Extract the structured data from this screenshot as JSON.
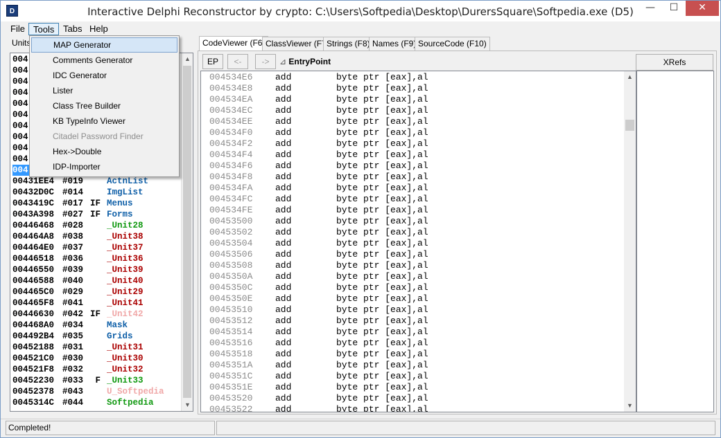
{
  "window": {
    "title": "Interactive Delphi Reconstructor by crypto: C:\\Users\\Softpedia\\Desktop\\DurersSquare\\Softpedia.exe (D5)",
    "icon_text": "D",
    "minimize": "—",
    "maximize": "☐",
    "close": "✕"
  },
  "menu": [
    "File",
    "Tools",
    "Tabs",
    "Help"
  ],
  "tools_menu": {
    "items": [
      {
        "label": "MAP Generator",
        "state": "highlighted"
      },
      {
        "label": "Comments Generator",
        "state": "normal"
      },
      {
        "label": "IDC Generator",
        "state": "normal"
      },
      {
        "label": "Lister",
        "state": "normal"
      },
      {
        "label": "Class Tree Builder",
        "state": "normal"
      },
      {
        "label": "KB TypeInfo Viewer",
        "state": "normal"
      },
      {
        "label": "Citadel Password Finder",
        "state": "disabled"
      },
      {
        "label": "Hex->Double",
        "state": "normal"
      },
      {
        "label": "IDP-Importer",
        "state": "normal"
      }
    ]
  },
  "left_panel": {
    "header": "Units",
    "hidden_rows": [
      {
        "addr": "004",
        "num": ""
      },
      {
        "addr": "004",
        "num": ""
      },
      {
        "addr": "004",
        "num": ""
      },
      {
        "addr": "004",
        "num": ""
      },
      {
        "addr": "004",
        "num": ""
      },
      {
        "addr": "004",
        "num": ""
      },
      {
        "addr": "004",
        "num": ""
      },
      {
        "addr": "004",
        "num": ""
      },
      {
        "addr": "004",
        "num": ""
      },
      {
        "addr": "004",
        "num": ""
      },
      {
        "addr": "004",
        "num": ""
      }
    ],
    "rows": [
      {
        "addr": "00431EE4",
        "num": "#019",
        "flags": "",
        "name": "ActnList",
        "color": "#1060a8"
      },
      {
        "addr": "00432D0C",
        "num": "#014",
        "flags": "",
        "name": "ImgList",
        "color": "#1060a8"
      },
      {
        "addr": "0043419C",
        "num": "#017",
        "flags": "IF",
        "name": "Menus",
        "color": "#1060a8"
      },
      {
        "addr": "0043A398",
        "num": "#027",
        "flags": "IF",
        "name": "Forms",
        "color": "#1060a8"
      },
      {
        "addr": "00446468",
        "num": "#028",
        "flags": "",
        "name": "_Unit28",
        "color": "#119911"
      },
      {
        "addr": "004464A8",
        "num": "#038",
        "flags": "",
        "name": "_Unit38",
        "color": "#aa0000"
      },
      {
        "addr": "004464E0",
        "num": "#037",
        "flags": "",
        "name": "_Unit37",
        "color": "#aa0000"
      },
      {
        "addr": "00446518",
        "num": "#036",
        "flags": "",
        "name": "_Unit36",
        "color": "#aa0000"
      },
      {
        "addr": "00446550",
        "num": "#039",
        "flags": "",
        "name": "_Unit39",
        "color": "#aa0000"
      },
      {
        "addr": "00446588",
        "num": "#040",
        "flags": "",
        "name": "_Unit40",
        "color": "#aa0000"
      },
      {
        "addr": "004465C0",
        "num": "#029",
        "flags": "",
        "name": "_Unit29",
        "color": "#aa0000"
      },
      {
        "addr": "004465F8",
        "num": "#041",
        "flags": "",
        "name": "_Unit41",
        "color": "#aa0000"
      },
      {
        "addr": "00446630",
        "num": "#042",
        "flags": "IF",
        "name": "_Unit42",
        "color": "#f0a8a8"
      },
      {
        "addr": "004468A0",
        "num": "#034",
        "flags": "",
        "name": "Mask",
        "color": "#1060a8"
      },
      {
        "addr": "004492B4",
        "num": "#035",
        "flags": "",
        "name": "Grids",
        "color": "#1060a8"
      },
      {
        "addr": "00452188",
        "num": "#031",
        "flags": "",
        "name": "_Unit31",
        "color": "#aa0000"
      },
      {
        "addr": "004521C0",
        "num": "#030",
        "flags": "",
        "name": "_Unit30",
        "color": "#aa0000"
      },
      {
        "addr": "004521F8",
        "num": "#032",
        "flags": "",
        "name": "_Unit32",
        "color": "#aa0000"
      },
      {
        "addr": "00452230",
        "num": "#033",
        "flags": " F",
        "name": "_Unit33",
        "color": "#119911"
      },
      {
        "addr": "00452378",
        "num": "#043",
        "flags": "",
        "name": "U_Softpedia",
        "color": "#f0a8a8"
      },
      {
        "addr": "0045314C",
        "num": "#044",
        "flags": "",
        "name": "Softpedia",
        "color": "#119911"
      }
    ]
  },
  "tabs": [
    "CodeViewer (F6)",
    "ClassViewer (F7)",
    "Strings (F8)",
    "Names (F9)",
    "SourceCode (F10)"
  ],
  "code_toolbar": {
    "ep_button": "EP",
    "back_button": "<-",
    "fwd_button": "->",
    "location": "EntryPoint",
    "xrefs": "XRefs"
  },
  "code_lines": [
    {
      "addr": "004534E6",
      "mn": "add",
      "op": "byte ptr [eax],al"
    },
    {
      "addr": "004534E8",
      "mn": "add",
      "op": "byte ptr [eax],al"
    },
    {
      "addr": "004534EA",
      "mn": "add",
      "op": "byte ptr [eax],al"
    },
    {
      "addr": "004534EC",
      "mn": "add",
      "op": "byte ptr [eax],al"
    },
    {
      "addr": "004534EE",
      "mn": "add",
      "op": "byte ptr [eax],al"
    },
    {
      "addr": "004534F0",
      "mn": "add",
      "op": "byte ptr [eax],al"
    },
    {
      "addr": "004534F2",
      "mn": "add",
      "op": "byte ptr [eax],al"
    },
    {
      "addr": "004534F4",
      "mn": "add",
      "op": "byte ptr [eax],al"
    },
    {
      "addr": "004534F6",
      "mn": "add",
      "op": "byte ptr [eax],al"
    },
    {
      "addr": "004534F8",
      "mn": "add",
      "op": "byte ptr [eax],al"
    },
    {
      "addr": "004534FA",
      "mn": "add",
      "op": "byte ptr [eax],al"
    },
    {
      "addr": "004534FC",
      "mn": "add",
      "op": "byte ptr [eax],al"
    },
    {
      "addr": "004534FE",
      "mn": "add",
      "op": "byte ptr [eax],al"
    },
    {
      "addr": "00453500",
      "mn": "add",
      "op": "byte ptr [eax],al"
    },
    {
      "addr": "00453502",
      "mn": "add",
      "op": "byte ptr [eax],al"
    },
    {
      "addr": "00453504",
      "mn": "add",
      "op": "byte ptr [eax],al"
    },
    {
      "addr": "00453506",
      "mn": "add",
      "op": "byte ptr [eax],al"
    },
    {
      "addr": "00453508",
      "mn": "add",
      "op": "byte ptr [eax],al"
    },
    {
      "addr": "0045350A",
      "mn": "add",
      "op": "byte ptr [eax],al"
    },
    {
      "addr": "0045350C",
      "mn": "add",
      "op": "byte ptr [eax],al"
    },
    {
      "addr": "0045350E",
      "mn": "add",
      "op": "byte ptr [eax],al"
    },
    {
      "addr": "00453510",
      "mn": "add",
      "op": "byte ptr [eax],al"
    },
    {
      "addr": "00453512",
      "mn": "add",
      "op": "byte ptr [eax],al"
    },
    {
      "addr": "00453514",
      "mn": "add",
      "op": "byte ptr [eax],al"
    },
    {
      "addr": "00453516",
      "mn": "add",
      "op": "byte ptr [eax],al"
    },
    {
      "addr": "00453518",
      "mn": "add",
      "op": "byte ptr [eax],al"
    },
    {
      "addr": "0045351A",
      "mn": "add",
      "op": "byte ptr [eax],al"
    },
    {
      "addr": "0045351C",
      "mn": "add",
      "op": "byte ptr [eax],al"
    },
    {
      "addr": "0045351E",
      "mn": "add",
      "op": "byte ptr [eax],al"
    },
    {
      "addr": "00453520",
      "mn": "add",
      "op": "byte ptr [eax],al"
    },
    {
      "addr": "00453522",
      "mn": "add",
      "op": "byte ptr [eax],al"
    }
  ],
  "status": "Completed!"
}
